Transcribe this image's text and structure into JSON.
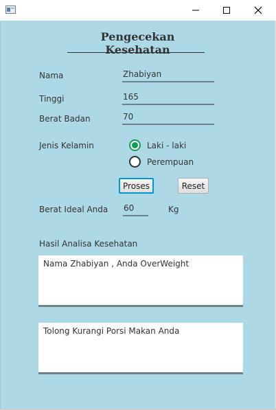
{
  "window": {
    "minimize_glyph": "—",
    "maximize_glyph": "☐",
    "close_glyph": "✕"
  },
  "form": {
    "title": "Pengecekan Kesehatan",
    "name_label": "Nama",
    "name_value": "Zhabiyan",
    "height_label": "Tinggi",
    "height_value": "165",
    "weight_label": "Berat Badan",
    "weight_value": "70",
    "gender_label": "Jenis Kelamin",
    "gender_options": [
      "Laki - laki",
      "Perempuan"
    ],
    "gender_selected": "Laki - laki",
    "process_button": "Proses",
    "reset_button": "Reset",
    "ideal_weight_label": "Berat Ideal Anda",
    "ideal_weight_value": "60",
    "ideal_weight_unit": "Kg",
    "analysis_label": "Hasil Analisa Kesehatan",
    "analysis_text": "Nama Zhabiyan , Anda OverWeight",
    "advice_text": "Tolong Kurangi Porsi Makan Anda"
  },
  "colors": {
    "background": "#add8e6",
    "radio_selected": "#0f9d58",
    "focus_border": "#0096c9"
  }
}
